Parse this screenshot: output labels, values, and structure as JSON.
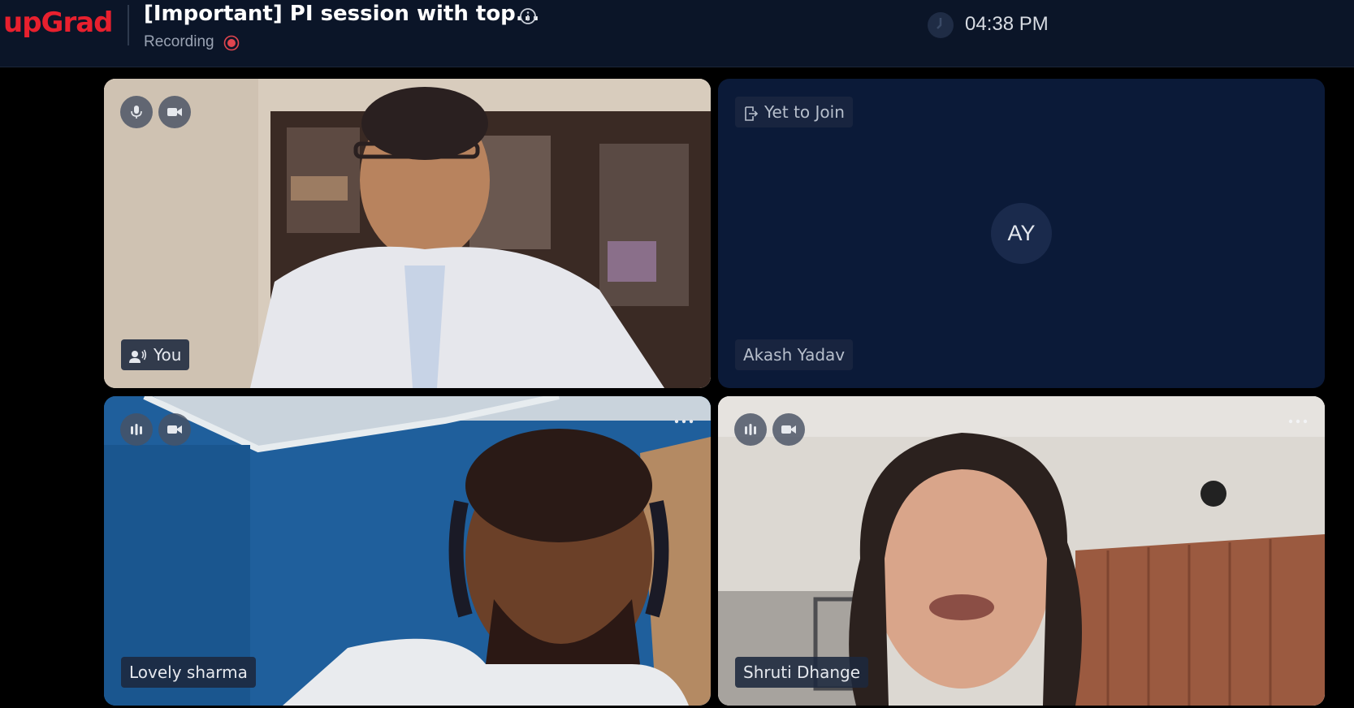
{
  "header": {
    "logo": "upGrad",
    "session_title": "[Important] PI session with top...",
    "recording_label": "Recording",
    "time": "04:38 PM"
  },
  "tiles": [
    {
      "name": "You",
      "mic": "mic-icon",
      "camera": "camera-icon",
      "name_icon": "speaking-icon"
    },
    {
      "name": "Akash Yadav",
      "status": "Yet to Join",
      "initials": "AY"
    },
    {
      "name": "Lovely sharma",
      "mic": "audio-level-icon",
      "camera": "camera-icon"
    },
    {
      "name": "Shruti Dhange",
      "mic": "audio-level-icon",
      "camera": "camera-icon"
    }
  ],
  "colors": {
    "brand": "#e8202e",
    "header_bg": "#0b1528",
    "tile_empty_bg": "#0b1a38",
    "recording": "#e0454f"
  }
}
